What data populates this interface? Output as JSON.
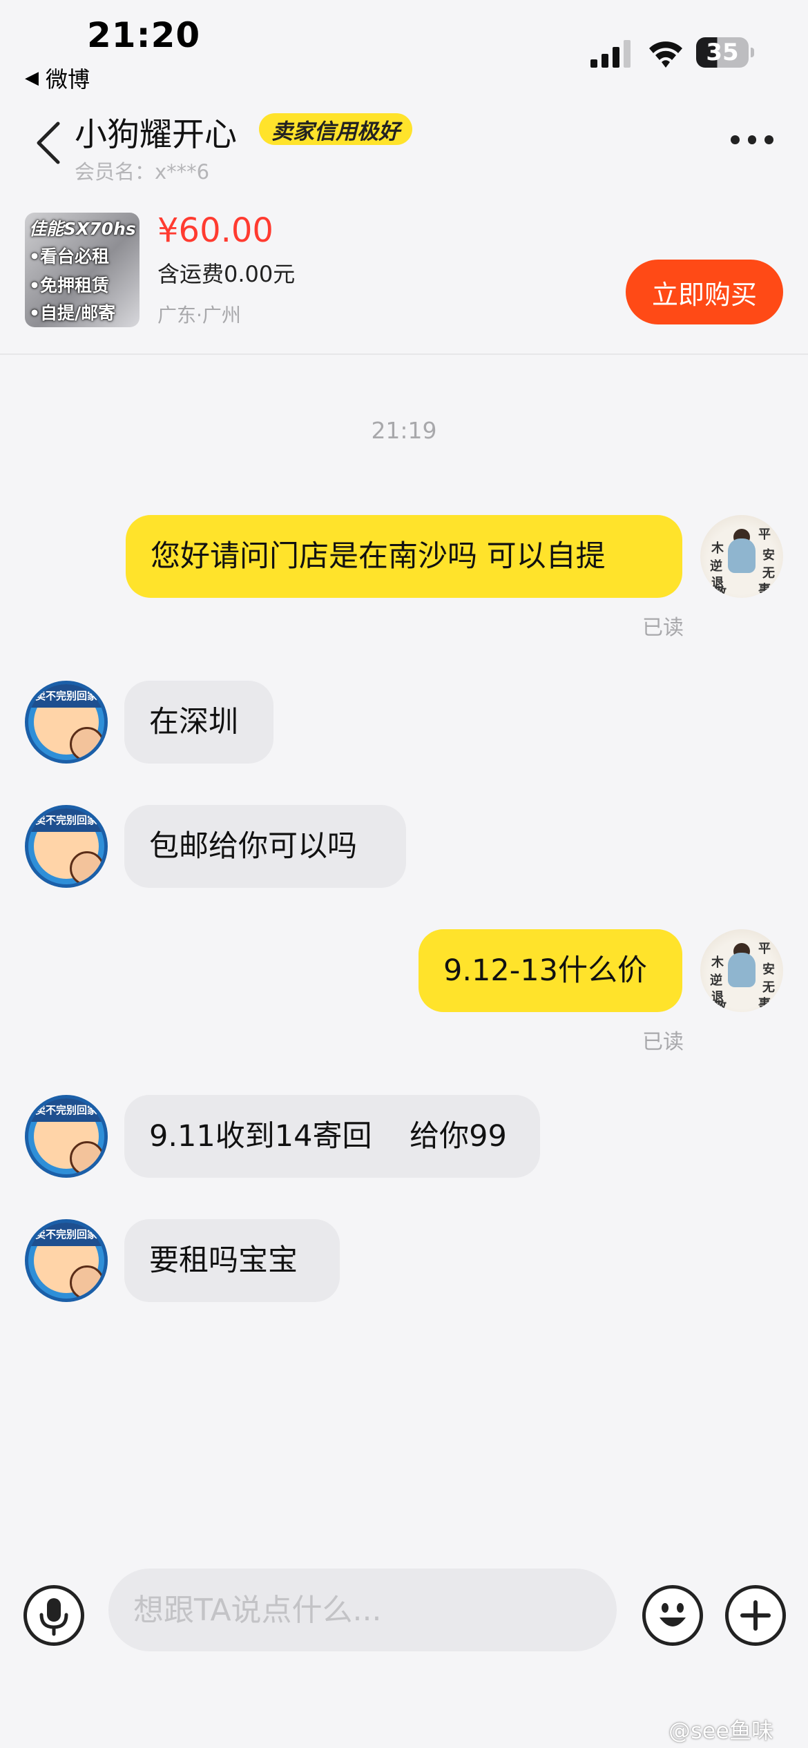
{
  "status_bar": {
    "time": "21:20",
    "back_app": "微博",
    "battery": "35"
  },
  "header": {
    "seller_name": "小狗耀开心",
    "credit_badge": "卖家信用极好",
    "member_label": "会员名：x***6"
  },
  "product": {
    "thumbnail_lines": [
      "佳能SX70hs",
      "•看台必租",
      "•免押租赁",
      "•自提/邮寄"
    ],
    "price": "¥60.00",
    "shipping": "含运费0.00元",
    "location": "广东·广州",
    "buy_label": "立即购买"
  },
  "chat": {
    "timestamp": "21:19",
    "read_label": "已读",
    "messages": [
      {
        "from": "me",
        "text": "您好请问门店是在南沙吗 可以自提"
      },
      {
        "from": "seller",
        "text": "在深圳"
      },
      {
        "from": "seller",
        "text": "包邮给你可以吗"
      },
      {
        "from": "me",
        "text": "9.12-13什么价"
      },
      {
        "from": "seller",
        "text": "9.11收到14寄回    给你99"
      },
      {
        "from": "seller",
        "text": "要租吗宝宝"
      }
    ],
    "seller_avatar_caption": "卖不完别回家",
    "my_avatar_chars": [
      "木",
      "平",
      "安",
      "逆",
      "无",
      "退",
      "散",
      "事"
    ]
  },
  "input_bar": {
    "placeholder": "想跟TA说点什么..."
  },
  "watermark": "@see鱼味",
  "colors": {
    "accent_yellow": "#ffe32b",
    "price_red": "#ff3b30",
    "buy_orange": "#ff4a16"
  }
}
